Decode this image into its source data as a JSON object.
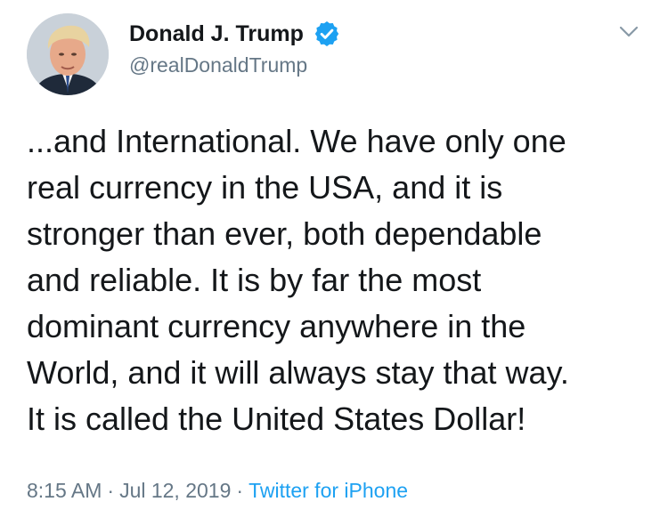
{
  "author": {
    "display_name": "Donald J. Trump",
    "handle": "@realDonaldTrump",
    "verified": true,
    "avatar": "profile-photo"
  },
  "tweet": {
    "lines": [
      "...and International. We have only one",
      "real currency in the USA, and it is",
      "stronger than ever, both dependable",
      "and reliable. It is by far the most",
      "dominant currency anywhere in the",
      "World, and it will always stay that way.",
      "It is called the United States Dollar!"
    ]
  },
  "meta": {
    "time": "8:15 AM",
    "separator": "·",
    "date": "Jul 12, 2019",
    "source": "Twitter for iPhone"
  },
  "colors": {
    "text": "#14171a",
    "secondary": "#657786",
    "link": "#1da1f2",
    "verified": "#1da1f2"
  },
  "icons": {
    "verified": "verified-badge-icon",
    "menu": "chevron-down-icon"
  }
}
